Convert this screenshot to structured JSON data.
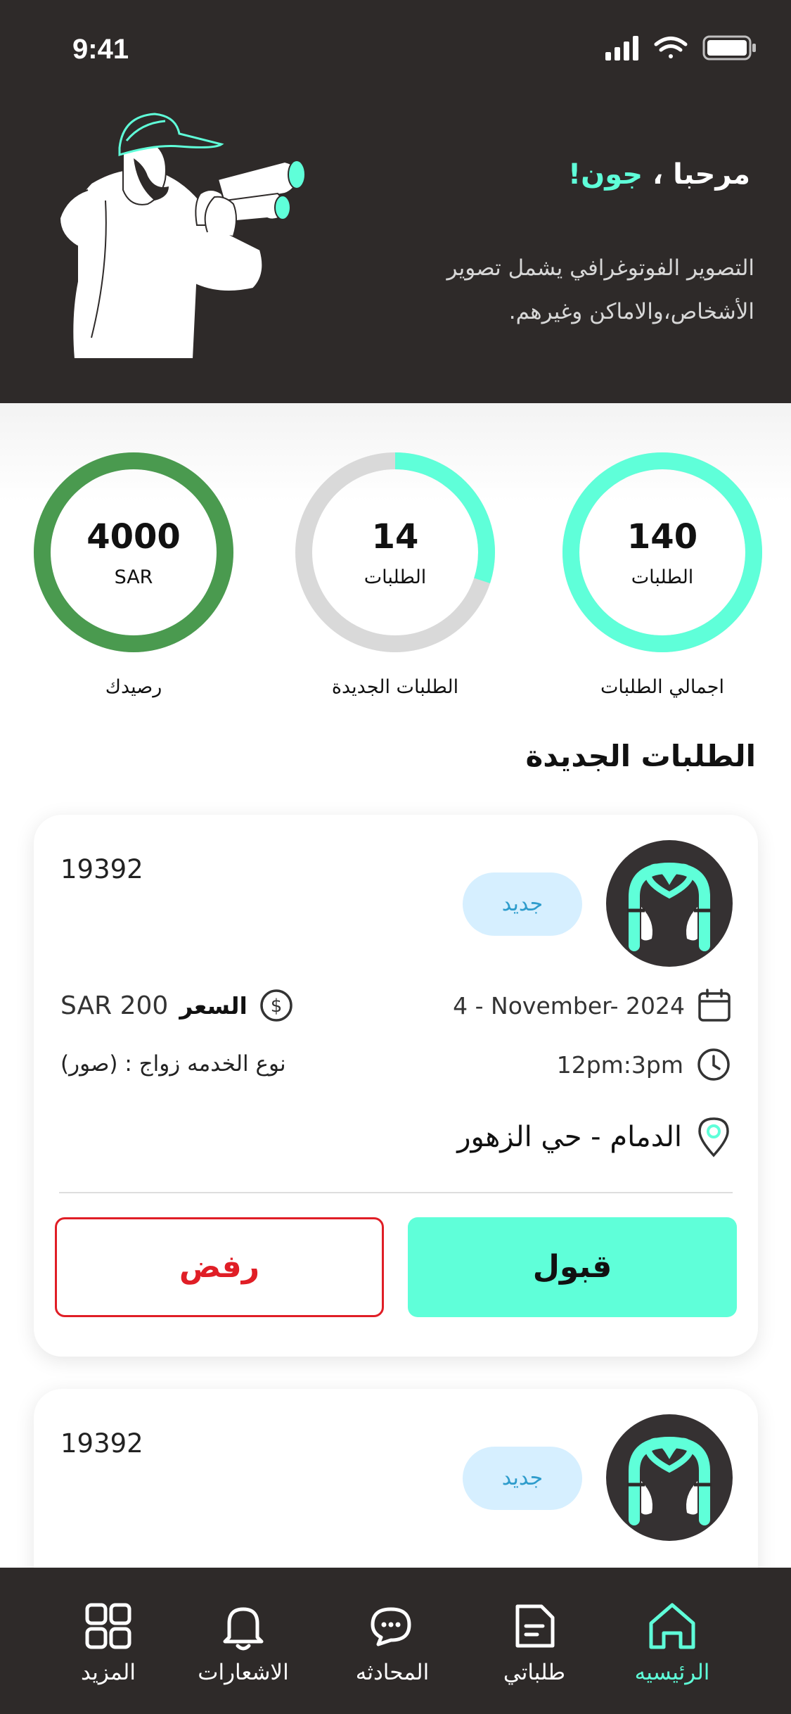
{
  "status_bar": {
    "time": "9:41"
  },
  "header": {
    "greeting_prefix": "مرحبا ، ",
    "name": "جون!",
    "description": "التصوير الفوتوغرافي يشمل تصوير الأشخاص،والاماكن وغيرهم."
  },
  "stats": [
    {
      "value": "140",
      "sub": "الطلبات",
      "label": "اجمالي الطلبات",
      "fill_fraction": 1.0,
      "color": "#5fffd9"
    },
    {
      "value": "14",
      "sub": "الطلبات",
      "label": "الطلبات الجديدة",
      "fill_fraction": 0.3,
      "color": "#5fffd9"
    },
    {
      "value": "4000",
      "sub": "SAR",
      "label": "رصيدك",
      "fill_fraction": 1.0,
      "color": "#4a9a4f"
    }
  ],
  "section_title": "الطلبات الجديدة",
  "cards": [
    {
      "id": "19392",
      "badge": "جديد",
      "date": "4 - November- 2024",
      "price_label": "السعر",
      "price_value": "SAR 200",
      "time": "12pm:3pm",
      "service": "نوع الخدمه زواج : (صور)",
      "location": "الدمام - حي الزهور",
      "accept": "قبول",
      "reject": "رفض"
    },
    {
      "id": "19392",
      "badge": "جديد"
    }
  ],
  "nav": [
    {
      "label": "الرئيسيه",
      "icon": "home-icon",
      "active": true
    },
    {
      "label": "طلباتي",
      "icon": "document-icon",
      "active": false
    },
    {
      "label": "المحادثه",
      "icon": "chat-icon",
      "active": false
    },
    {
      "label": "الاشعارات",
      "icon": "bell-icon",
      "active": false
    },
    {
      "label": "المزيد",
      "icon": "grid-icon",
      "active": false
    }
  ],
  "colors": {
    "accent": "#5fffd9",
    "dark": "#2e2a29",
    "balance_ring": "#4a9a4f",
    "reject": "#e01e26",
    "badge_bg": "#d6efff"
  }
}
